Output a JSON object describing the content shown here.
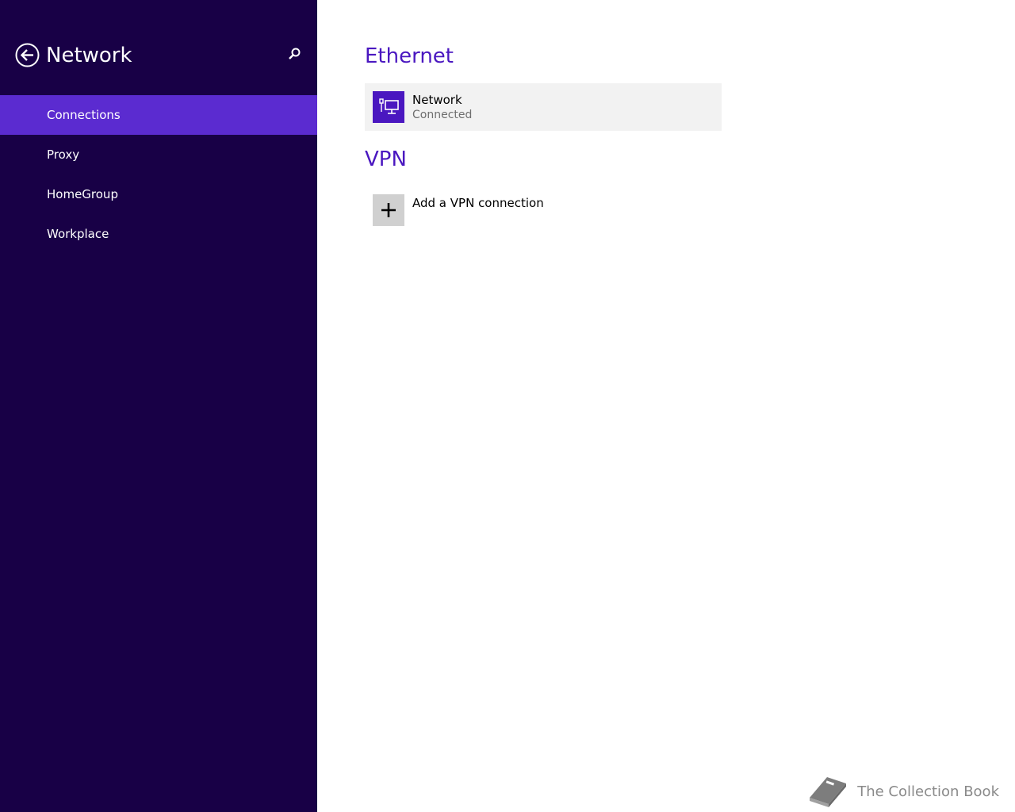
{
  "sidebar": {
    "title": "Network",
    "items": [
      {
        "label": "Connections",
        "selected": true
      },
      {
        "label": "Proxy",
        "selected": false
      },
      {
        "label": "HomeGroup",
        "selected": false
      },
      {
        "label": "Workplace",
        "selected": false
      }
    ],
    "icons": {
      "back": "back-arrow-circle-icon",
      "search": "search-icon"
    }
  },
  "main": {
    "ethernet": {
      "heading": "Ethernet",
      "connection": {
        "name": "Network",
        "status": "Connected",
        "icon": "wired-network-icon"
      }
    },
    "vpn": {
      "heading": "VPN",
      "add_label": "Add a VPN connection",
      "icon": "plus-icon"
    }
  },
  "watermark": {
    "text": "The Collection Book",
    "icon": "book-icon"
  },
  "colors": {
    "sidebar_bg": "#180046",
    "selected_bg": "#5b2bd0",
    "accent": "#4a17c0",
    "tile_bg": "#f2f2f2"
  }
}
